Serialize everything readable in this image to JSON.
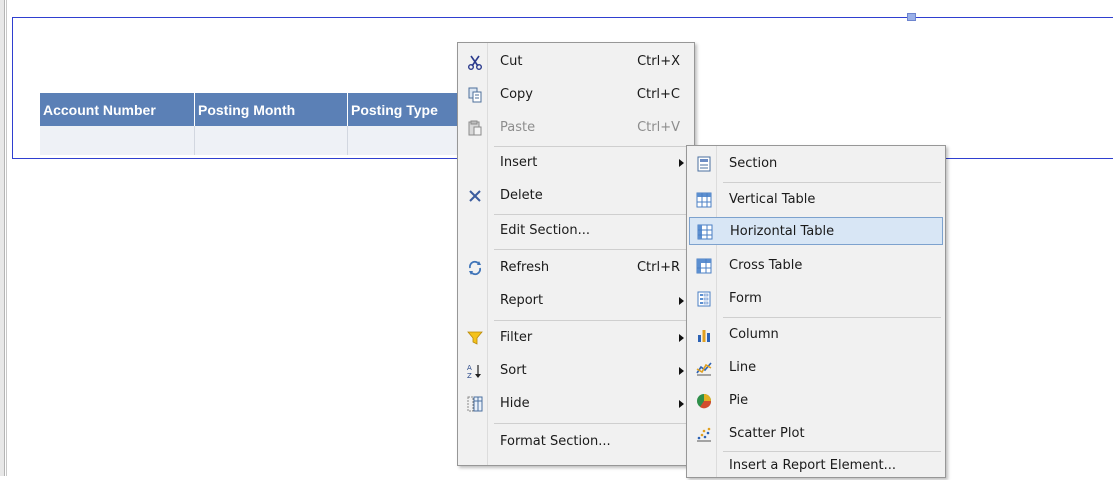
{
  "table": {
    "headers": [
      "Account Number",
      "Posting Month",
      "Posting Type"
    ]
  },
  "context_menu": {
    "items": [
      {
        "label": "Cut",
        "shortcut": "Ctrl+X",
        "icon": "scissors-icon"
      },
      {
        "label": "Copy",
        "shortcut": "Ctrl+C",
        "icon": "copy-icon"
      },
      {
        "label": "Paste",
        "shortcut": "Ctrl+V",
        "icon": "paste-icon",
        "disabled": true
      },
      {
        "label": "Insert",
        "submenu": true
      },
      {
        "label": "Delete",
        "icon": "delete-icon"
      },
      {
        "label": "Edit Section..."
      },
      {
        "label": "Refresh",
        "shortcut": "Ctrl+R",
        "icon": "refresh-icon"
      },
      {
        "label": "Report",
        "submenu": true
      },
      {
        "label": "Filter",
        "icon": "filter-icon",
        "submenu": true
      },
      {
        "label": "Sort",
        "icon": "sort-icon",
        "submenu": true
      },
      {
        "label": "Hide",
        "icon": "hide-icon",
        "submenu": true
      },
      {
        "label": "Format Section..."
      }
    ]
  },
  "insert_submenu": {
    "items": [
      {
        "label": "Section",
        "icon": "section-icon"
      },
      {
        "label": "Vertical Table",
        "icon": "vertical-table-icon"
      },
      {
        "label": "Horizontal Table",
        "icon": "horizontal-table-icon",
        "highlighted": true
      },
      {
        "label": "Cross Table",
        "icon": "cross-table-icon"
      },
      {
        "label": "Form",
        "icon": "form-icon"
      },
      {
        "label": "Column",
        "icon": "column-chart-icon"
      },
      {
        "label": "Line",
        "icon": "line-chart-icon"
      },
      {
        "label": "Pie",
        "icon": "pie-chart-icon"
      },
      {
        "label": "Scatter Plot",
        "icon": "scatter-plot-icon"
      },
      {
        "label": "Insert a Report Element..."
      }
    ]
  },
  "colors": {
    "table_header": "#5b80b6",
    "section_border": "#2f3fd0",
    "menu_background": "#f1f1f1",
    "highlight": "#d8e6f5"
  }
}
